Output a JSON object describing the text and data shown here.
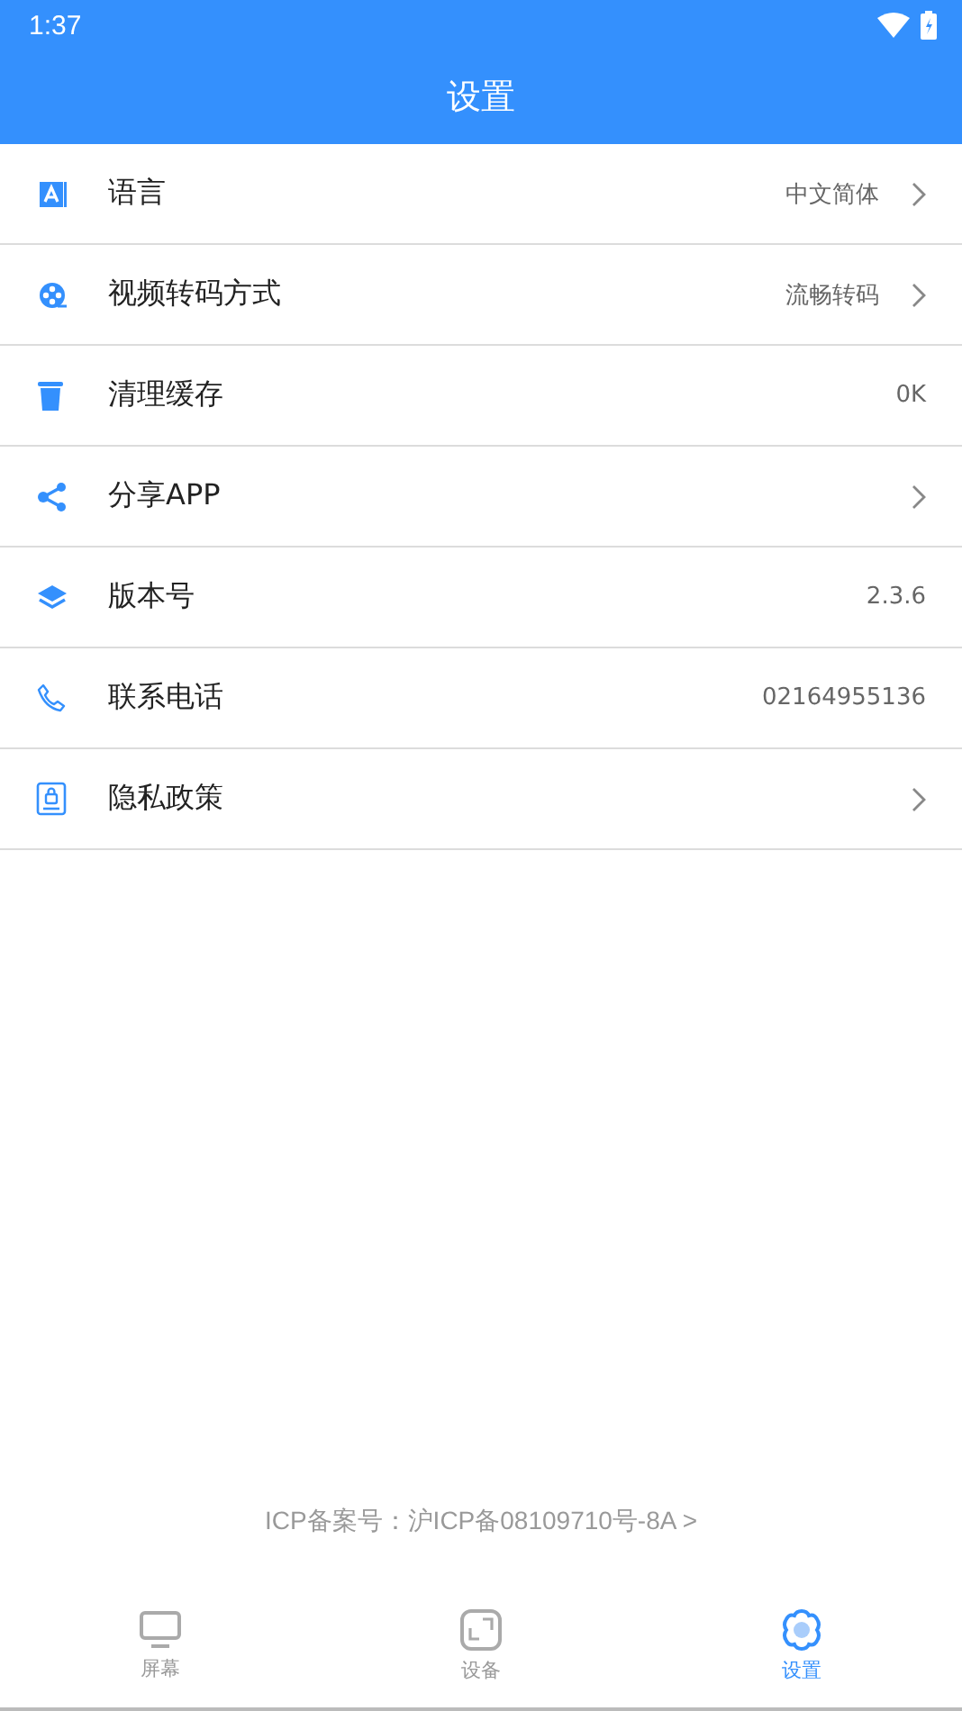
{
  "status_bar": {
    "time": "1:37"
  },
  "header": {
    "title": "设置"
  },
  "items": [
    {
      "kind": "link",
      "label": "语言",
      "value": "中文简体"
    },
    {
      "kind": "link",
      "label": "视频转码方式",
      "value": "流畅转码"
    },
    {
      "kind": "info",
      "label": "清理缓存",
      "value": "0K"
    },
    {
      "kind": "link",
      "label": "分享APP"
    },
    {
      "kind": "info",
      "label": "版本号",
      "value": "2.3.6"
    },
    {
      "kind": "info",
      "label": "联系电话",
      "value": "02164955136"
    },
    {
      "kind": "link",
      "label": "隐私政策"
    }
  ],
  "footer": {
    "icp": "ICP备案号：沪ICP备08109710号-8A >"
  },
  "tabs": [
    {
      "label": "屏幕",
      "selected": false
    },
    {
      "label": "设备",
      "selected": false
    },
    {
      "label": "设置",
      "selected": true
    }
  ]
}
